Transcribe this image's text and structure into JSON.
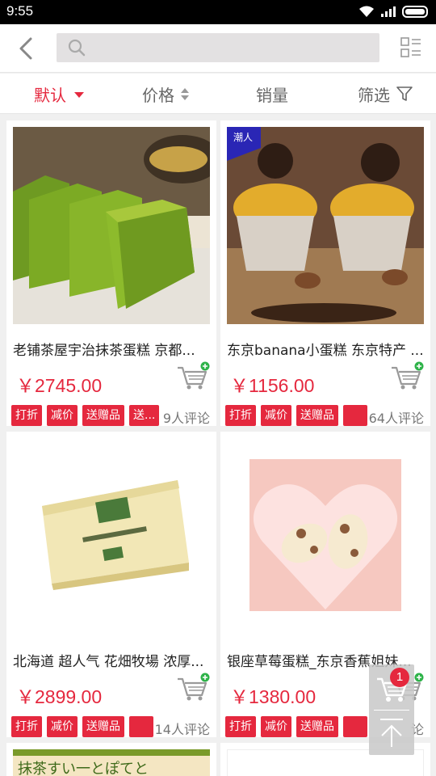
{
  "status_bar": {
    "time": "9:55"
  },
  "header": {
    "search": {
      "value": "",
      "placeholder": ""
    }
  },
  "sort_bar": {
    "default_label": "默认",
    "price_label": "价格",
    "sales_label": "销量",
    "filter_label": "筛选"
  },
  "accent_color": "#e5283e",
  "products": [
    {
      "name": "老铺茶屋宇治抹茶蛋糕 京都...",
      "price": "￥2745.00",
      "tags": [
        "打折",
        "减价",
        "送赠品",
        "送..."
      ],
      "reviews": "9人评论",
      "image": "matcha-pound-cake-photo"
    },
    {
      "name": "东京banana小蛋糕 东京特产 ...",
      "price": "￥1156.00",
      "tags": [
        "打折",
        "减价",
        "送赠品",
        ""
      ],
      "reviews": "64人评论",
      "badge": "潮人",
      "image": "chocolate-cupcake-photo"
    },
    {
      "name": "北海道 超人气 花畑牧場 浓厚...",
      "price": "￥2899.00",
      "tags": [
        "打折",
        "减价",
        "送赠品",
        ""
      ],
      "reviews": "14人评论",
      "image": "cheese-tart-box-photo"
    },
    {
      "name": "银座草莓蛋糕_东京香蕉姐妹...",
      "price": "￥1380.00",
      "tags": [
        "打折",
        "减价",
        "送赠品",
        ""
      ],
      "reviews": "论",
      "image": "strawberry-banana-cake-photo"
    }
  ],
  "partial_card": {
    "banner_text": "抹茶すい一とぽてと"
  },
  "floating_cart": {
    "count": "1"
  }
}
